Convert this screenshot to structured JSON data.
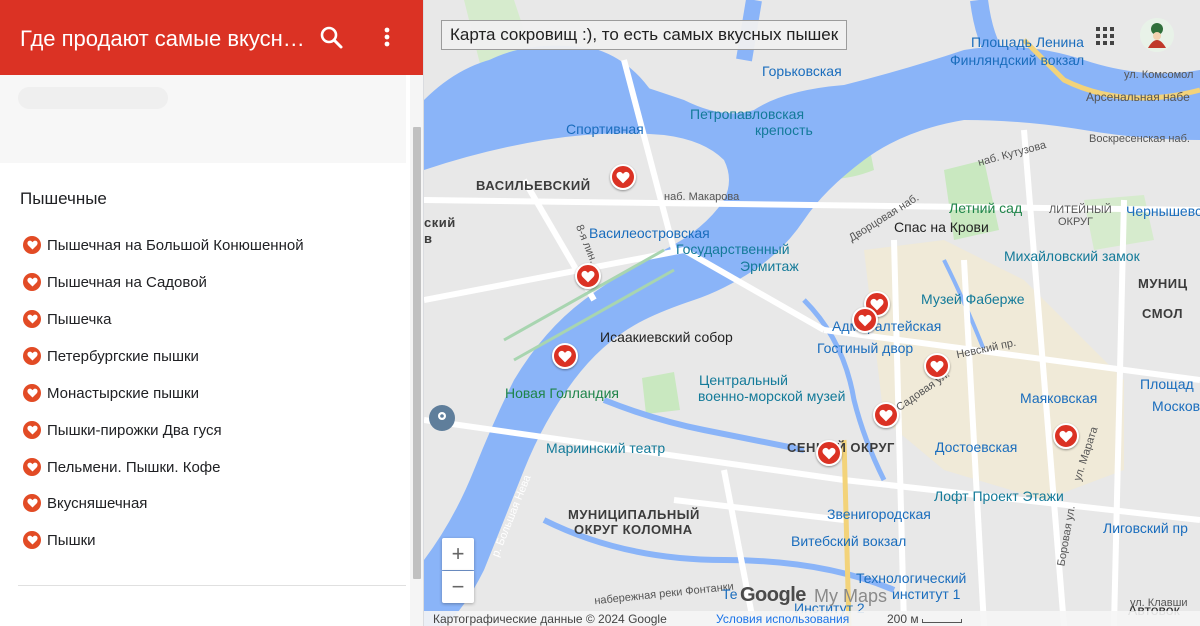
{
  "header": {
    "title": "Где продают самые вкусные пышки",
    "search_icon": "search-icon",
    "menu_icon": "more-vert-icon",
    "color": "#db3224"
  },
  "layer": {
    "title": "Пышечные",
    "icon": "heart-marker-icon",
    "items": [
      {
        "label": "Пышечная на Большой Конюшенной"
      },
      {
        "label": "Пышечная на Садовой"
      },
      {
        "label": "Пышечка"
      },
      {
        "label": "Петербургские пышки"
      },
      {
        "label": "Монастырские пышки"
      },
      {
        "label": "Пышки-пирожки Два гуся"
      },
      {
        "label": "Пельмени. Пышки. Кофе"
      },
      {
        "label": "Вкусняшечная"
      },
      {
        "label": "Пышки"
      }
    ]
  },
  "map": {
    "title_box": "Карта сокровищ :), то есть самых вкусных пышек",
    "apps_icon": "apps-grid-icon",
    "avatar_icon": "user-avatar-icon",
    "labels": {
      "vasilievsky": "ВАСИЛЬЕВСКИЙ",
      "sportivnaya": "Спортивная",
      "gorkovskaya": "Горьковская",
      "petropavlovskaya": "Петропавловская",
      "krepost": "крепость",
      "ploshad_lenina": "Площадь Ленина",
      "finlyandsky": "Финляндский вокзал",
      "ul_komsomol": "ул. Комсомол",
      "arsenalnaya": "Арсенальная набе",
      "voskresenskaya": "Воскресенская наб.",
      "nab_kutuzova": "наб. Кутузова",
      "nab_makarova": "наб. Макарова",
      "vasileostrovskaya": "Василеостровская",
      "gos": "Государственный",
      "ermitazh": "Эрмитаж",
      "dvortsovaya": "Дворцовая наб.",
      "letny_sad": "Летний сад",
      "liteyny": "ЛИТЕЙНЫЙ",
      "okrug1": "ОКРУГ",
      "chernyshevskaya": "Чернышевская",
      "spas": "Спас на Крови",
      "mikhailovsky": "Михайловский замок",
      "muni": "МУНИЦ",
      "smol": "СМОЛ",
      "faberzhe": "Музей Фаберже",
      "admiralteyskaya": "Адмиралтейская",
      "gostiny": "Гостиный двор",
      "nevsky": "Невский пр.",
      "sadovaya": "Садовая ул.",
      "isaakievsky": "Исаакиевский собор",
      "novaya_gollandiya": "Новая Голландия",
      "tsentralny": "Центральный",
      "voenno": "военно-морской музей",
      "mariinsky": "Мариинский театр",
      "senny": "СЕННОЙ ОКРУГ",
      "mayakovskaya": "Маяковская",
      "ploshad": "Площад",
      "moskov": "Москов",
      "dostoevskaya": "Достоевская",
      "ul_marata": "ул. Марата",
      "loft": "Лофт Проект Этажи",
      "zvenigorodskaya": "Звенигородская",
      "ligovsky": "Лиговский пр",
      "vitebsky": "Витебский вокзал",
      "boravaya": "Боровая ул.",
      "munitsipalny": "МУНИЦИПАЛЬНЫЙ",
      "okrug_kolomna": "ОКРУГ КОЛОМНА",
      "bolshaya_neva": "р. Большая Нева",
      "fontanka": "набережная реки Фонтанки",
      "tekhnologichesky": "Технологический",
      "institut1": "институт 1",
      "institut2": "Институт 2",
      "te": "Те",
      "avtovok": "Автовок",
      "ul_kavshi": "ул. Клавши",
      "sky": "ский",
      "v": "в",
      "lin": "8-я лин."
    },
    "logo_google": "Google",
    "logo_mymaps": "My Maps",
    "zoom_in": "+",
    "zoom_out": "−",
    "footer_attrib": "Картографические данные © 2024 Google",
    "footer_terms": "Условия использования",
    "footer_scale": "200 м",
    "marker_color": "#db3224",
    "water_color": "#8ab4f8",
    "park_color": "#c9e8c0"
  }
}
